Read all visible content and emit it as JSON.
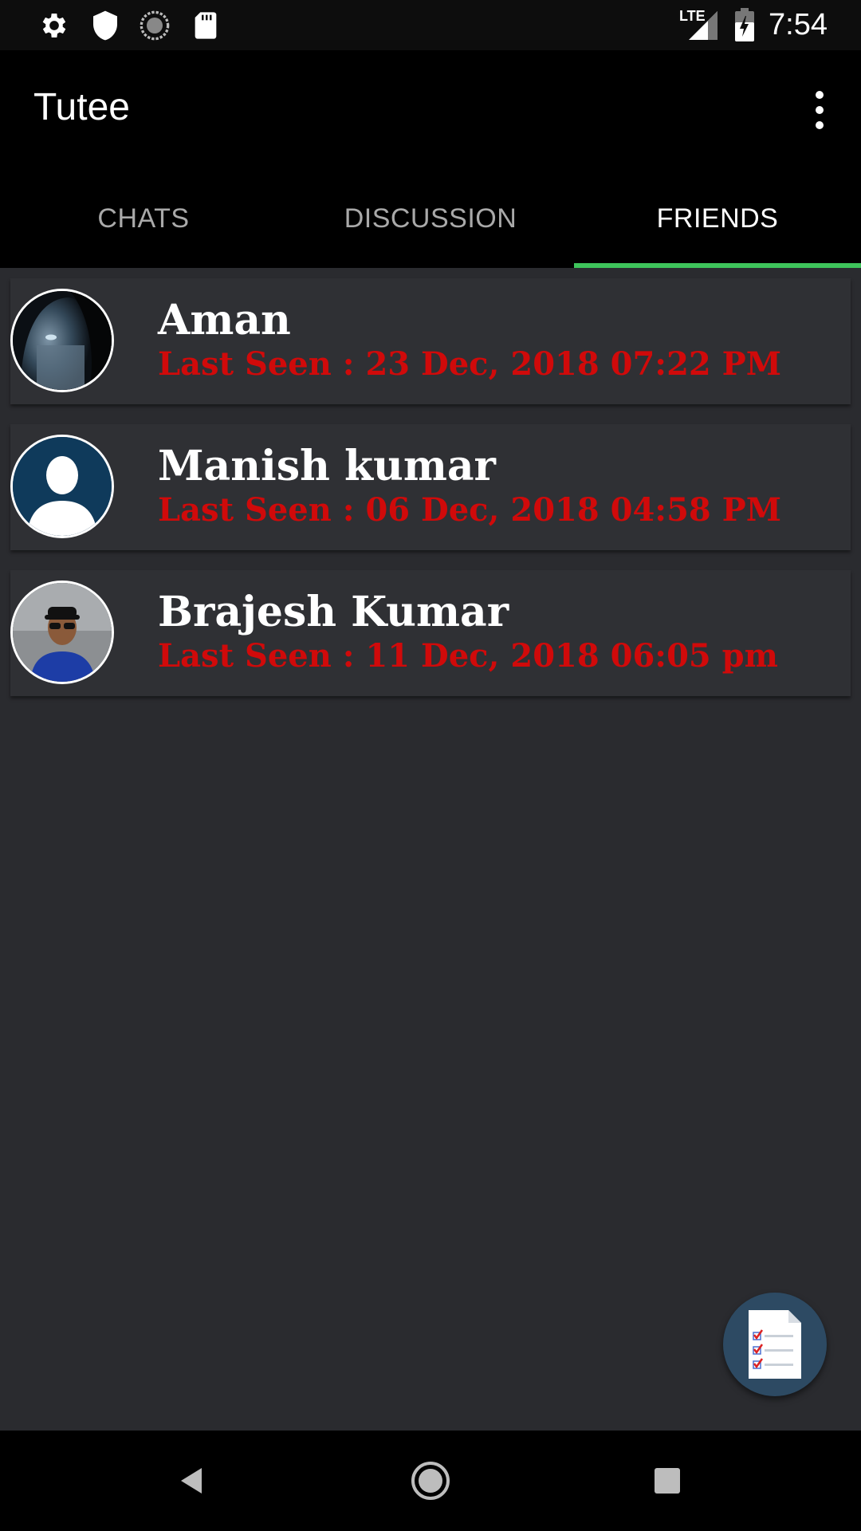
{
  "status_bar": {
    "time": "7:54",
    "network": "LTE",
    "icons": [
      "settings-icon",
      "shield-icon",
      "sync-icon",
      "sd-card-icon",
      "signal-icon",
      "battery-charging-icon"
    ]
  },
  "app_bar": {
    "title": "Tutee",
    "overflow_icon": "more-vertical-icon"
  },
  "tabs": [
    {
      "label": "CHATS",
      "active": false
    },
    {
      "label": "DISCUSSION",
      "active": false
    },
    {
      "label": "FRIENDS",
      "active": true
    }
  ],
  "friends": [
    {
      "name": "Aman",
      "last_seen": "Last Seen : 23 Dec, 2018 07:22 PM",
      "avatar": "hooded-person-photo"
    },
    {
      "name": "Manish kumar",
      "last_seen": "Last Seen : 06 Dec, 2018 04:58 PM",
      "avatar": "default-user-icon"
    },
    {
      "name": "Brajesh Kumar",
      "last_seen": "Last Seen : 11 Dec, 2018 06:05 pm",
      "avatar": "man-with-cap-photo"
    }
  ],
  "fab": {
    "icon": "checklist-icon"
  },
  "nav_bar": {
    "icons": [
      "back-icon",
      "home-icon",
      "recents-icon"
    ]
  },
  "colors": {
    "accent": "#3ec45b",
    "last_seen": "#d00a0a",
    "background": "#2a2b2f",
    "fab": "#2d4a63"
  }
}
